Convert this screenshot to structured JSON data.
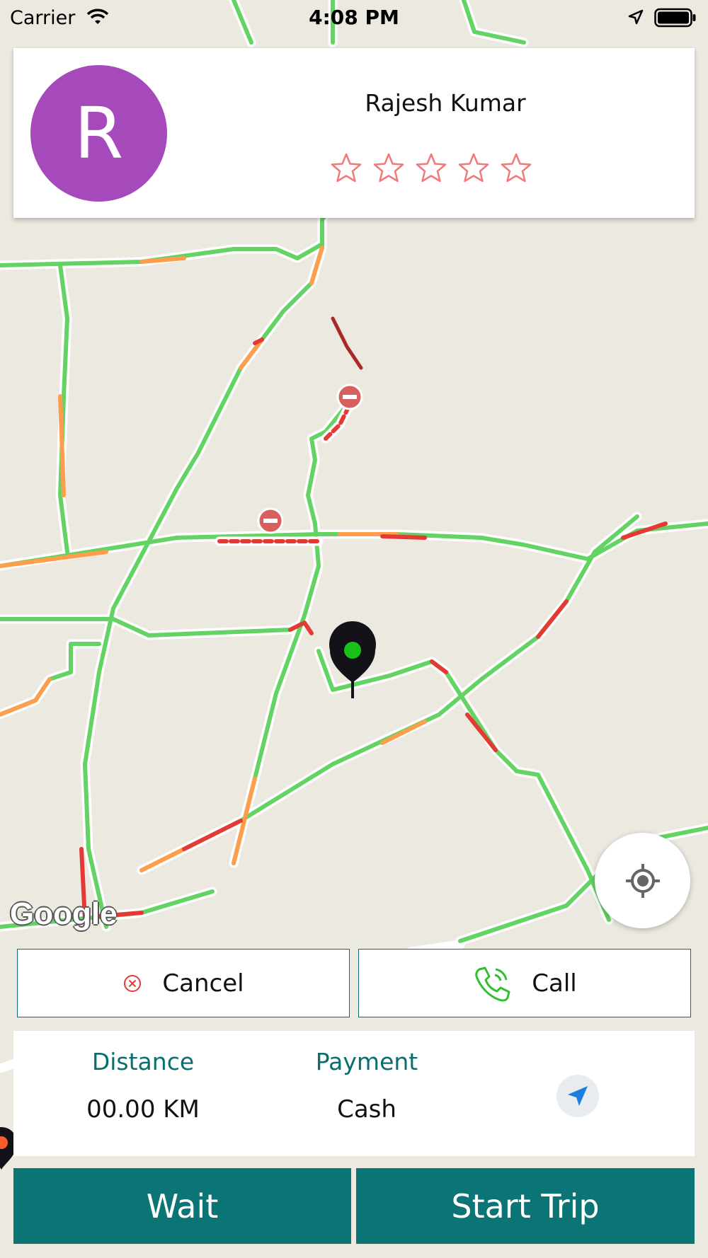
{
  "status_bar": {
    "carrier": "Carrier",
    "time": "4:08 PM"
  },
  "driver": {
    "initial": "R",
    "name": "Rajesh Kumar",
    "rating_stars": 5,
    "rating_value": 0
  },
  "map": {
    "attribution": "Google"
  },
  "actions": {
    "cancel_label": "Cancel",
    "call_label": "Call"
  },
  "trip_info": {
    "distance_label": "Distance",
    "distance_value": "00.00 KM",
    "payment_label": "Payment",
    "payment_value": "Cash"
  },
  "footer": {
    "wait_label": "Wait",
    "start_trip_label": "Start Trip"
  },
  "colors": {
    "accent": "#0b7575",
    "avatar": "#a649bb",
    "star_outline": "#f07a7a",
    "traffic_green": "#63d363",
    "traffic_orange": "#ff9d4d",
    "traffic_red": "#e53935"
  },
  "icons": {
    "wifi": "wifi-icon",
    "location": "location-arrow-icon",
    "battery": "battery-icon",
    "cancel": "cancel-x-icon",
    "call": "phone-icon",
    "recenter": "crosshair-icon",
    "navigate": "navigation-arrow-icon",
    "pin": "map-pin-icon"
  }
}
